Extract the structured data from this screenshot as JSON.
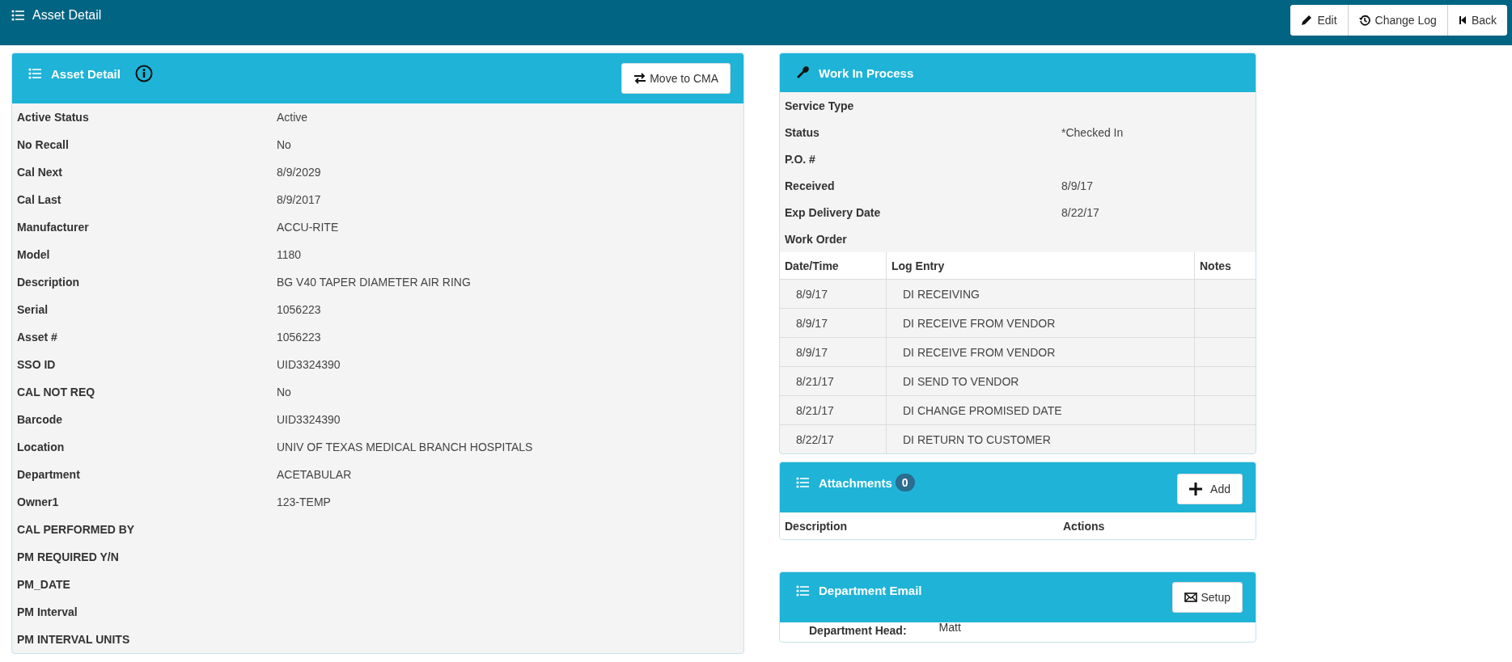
{
  "page_title": "Asset Detail",
  "toolbar": [
    "Edit",
    "Change Log",
    "Back"
  ],
  "asset_detail": {
    "title": "Asset Detail",
    "button": "Move to CMA",
    "fields": [
      {
        "label": "Active Status",
        "value": "Active"
      },
      {
        "label": "No Recall",
        "value": "No"
      },
      {
        "label": "Cal Next",
        "value": "8/9/2029"
      },
      {
        "label": "Cal Last",
        "value": "8/9/2017"
      },
      {
        "label": "Manufacturer",
        "value": "ACCU-RITE"
      },
      {
        "label": "Model",
        "value": "1180"
      },
      {
        "label": "Description",
        "value": "BG V40 TAPER DIAMETER AIR RING"
      },
      {
        "label": "Serial",
        "value": "1056223"
      },
      {
        "label": "Asset #",
        "value": "1056223"
      },
      {
        "label": "SSO ID",
        "value": "UID3324390"
      },
      {
        "label": "CAL NOT REQ",
        "value": "No"
      },
      {
        "label": "Barcode",
        "value": "UID3324390"
      },
      {
        "label": "Location",
        "value": "UNIV OF TEXAS MEDICAL BRANCH HOSPITALS"
      },
      {
        "label": "Department",
        "value": "ACETABULAR"
      },
      {
        "label": "Owner1",
        "value": "123-TEMP"
      },
      {
        "label": "CAL PERFORMED BY"
      },
      {
        "label": "PM REQUIRED Y/N"
      },
      {
        "label": "PM_DATE"
      },
      {
        "label": "PM Interval"
      },
      {
        "label": "PM INTERVAL UNITS"
      }
    ]
  },
  "work_in_process": {
    "title": "Work In Process",
    "fields": [
      {
        "label": "Service Type"
      },
      {
        "label": "Status",
        "value": "*Checked In"
      },
      {
        "label": "P.O. #"
      },
      {
        "label": "Received",
        "value": "8/9/17"
      },
      {
        "label": "Exp Delivery Date",
        "value": "8/22/17"
      },
      {
        "label": "Work Order"
      }
    ],
    "log_columns": [
      "Date/Time",
      "Log Entry",
      "Notes"
    ],
    "log_rows": [
      {
        "date": "8/9/17",
        "entry": "DI RECEIVING"
      },
      {
        "date": "8/9/17",
        "entry": "DI RECEIVE FROM VENDOR"
      },
      {
        "date": "8/9/17",
        "entry": "DI RECEIVE FROM VENDOR"
      },
      {
        "date": "8/21/17",
        "entry": "DI SEND TO VENDOR"
      },
      {
        "date": "8/21/17",
        "entry": "DI CHANGE PROMISED DATE"
      },
      {
        "date": "8/22/17",
        "entry": "DI RETURN TO CUSTOMER"
      }
    ]
  },
  "attachments": {
    "title": "Attachments",
    "count": "0",
    "button": "Add",
    "columns": [
      "Description",
      "Actions"
    ]
  },
  "department_email": {
    "title": "Department Email",
    "button": "Setup",
    "fields": [
      {
        "label": "Department Head:",
        "value": "Matt"
      }
    ]
  }
}
